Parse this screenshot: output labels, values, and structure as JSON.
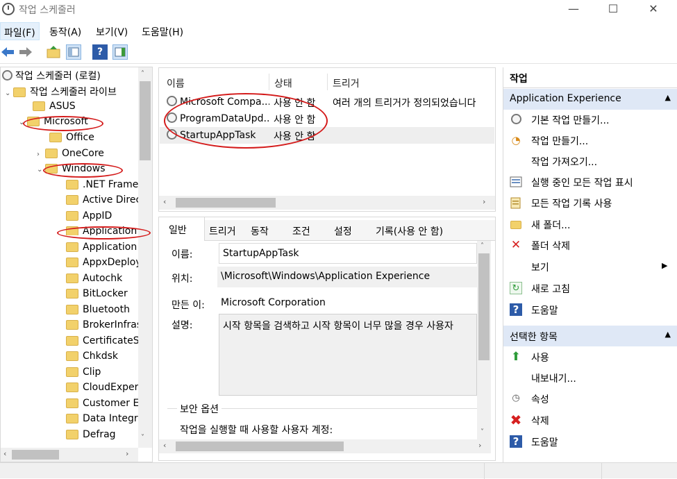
{
  "window": {
    "title": "작업 스케줄러",
    "minimize": "—",
    "maximize": "☐",
    "close": "✕"
  },
  "menu": [
    "파일(F)",
    "동작(A)",
    "보기(V)",
    "도움말(H)"
  ],
  "toolbar": {
    "back_icon": "back-arrow-icon",
    "forward_icon": "forward-arrow-icon",
    "help_label": "?"
  },
  "tree": {
    "items": [
      {
        "label": "작업 스케줄러 (로컬)"
      },
      {
        "label": "작업 스케줄러 라이브"
      },
      {
        "label": "ASUS"
      },
      {
        "label": "Microsoft"
      },
      {
        "label": "Office"
      },
      {
        "label": "OneCore"
      },
      {
        "label": "Windows"
      },
      {
        "label": ".NET Frame"
      },
      {
        "label": "Active Direc"
      },
      {
        "label": "AppID"
      },
      {
        "label": "Application"
      },
      {
        "label": "Application"
      },
      {
        "label": "AppxDeploy"
      },
      {
        "label": "Autochk"
      },
      {
        "label": "BitLocker"
      },
      {
        "label": "Bluetooth"
      },
      {
        "label": "BrokerInfras"
      },
      {
        "label": "CertificateSe"
      },
      {
        "label": "Chkdsk"
      },
      {
        "label": "Clip"
      },
      {
        "label": "CloudExper"
      },
      {
        "label": "Customer E"
      },
      {
        "label": "Data Integr"
      },
      {
        "label": "Defrag"
      }
    ]
  },
  "tasks": {
    "headers": [
      "이름",
      "상태",
      "트리거"
    ],
    "rows": [
      {
        "name": "Microsoft Compa...",
        "status": "사용 안 함",
        "trigger": "여러 개의 트리거가 정의되었습니다"
      },
      {
        "name": "ProgramDataUpd...",
        "status": "사용 안 함",
        "trigger": ""
      },
      {
        "name": "StartupAppTask",
        "status": "사용 안 함",
        "trigger": ""
      }
    ]
  },
  "details": {
    "tabs": [
      "일반",
      "트리거",
      "동작",
      "조건",
      "설정",
      "기록(사용 안 함)"
    ],
    "name_label": "이름:",
    "name_value": "StartupAppTask",
    "location_label": "위치:",
    "location_value": "\\Microsoft\\Windows\\Application Experience",
    "author_label": "만든 이:",
    "author_value": "Microsoft Corporation",
    "desc_label": "설명:",
    "desc_value": "시작 항목을 검색하고 시작 항목이 너무 많을 경우 사용자",
    "security_label": "보안 옵션",
    "security_text": "작업을 실행할 때 사용할 사용자 계정:"
  },
  "actions": {
    "header": "작업",
    "section1": "Application Experience",
    "items1": [
      {
        "label": "기본 작업 만들기...",
        "icon": "create-basic-task-icon"
      },
      {
        "label": "작업 만들기...",
        "icon": "create-task-icon"
      },
      {
        "label": "작업 가져오기...",
        "icon": ""
      },
      {
        "label": "실행 중인 모든 작업 표시",
        "icon": "running-tasks-icon"
      },
      {
        "label": "모든 작업 기록 사용",
        "icon": "history-icon"
      },
      {
        "label": "새 폴더...",
        "icon": "new-folder-icon"
      },
      {
        "label": "폴더 삭제",
        "icon": "delete-folder-icon"
      },
      {
        "label": "보기",
        "icon": ""
      },
      {
        "label": "새로 고침",
        "icon": "refresh-icon"
      },
      {
        "label": "도움말",
        "icon": "help-icon"
      }
    ],
    "section2": "선택한 항목",
    "items2": [
      {
        "label": "사용",
        "icon": "enable-icon"
      },
      {
        "label": "내보내기...",
        "icon": ""
      },
      {
        "label": "속성",
        "icon": "properties-icon"
      },
      {
        "label": "삭제",
        "icon": "delete-icon"
      },
      {
        "label": "도움말",
        "icon": "help-icon"
      }
    ]
  },
  "colors": {
    "accent_header": "#dfe8f6",
    "annotation": "#d41a1a",
    "help_blue": "#2d5ba8",
    "delete_red": "#d62020",
    "enable_green": "#2e9c3a"
  }
}
